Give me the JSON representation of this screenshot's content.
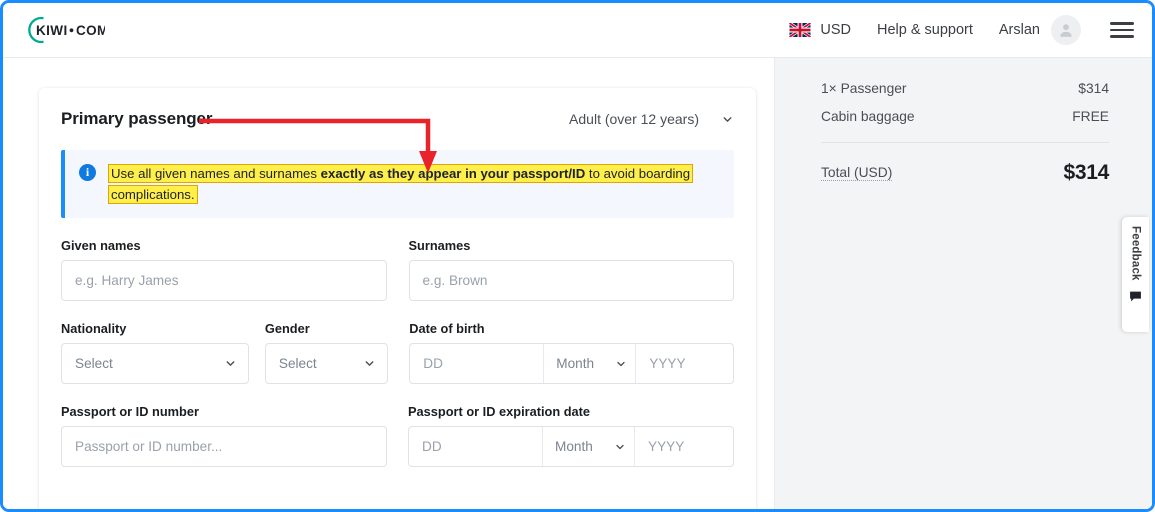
{
  "header": {
    "logo_text": "KIWI · COM",
    "logo_icon": "kiwi-circle-logo",
    "currency": "USD",
    "flag_icon": "uk-flag-icon",
    "help": "Help & support",
    "user_name": "Arslan",
    "avatar_icon": "user-avatar-icon",
    "menu_icon": "hamburger-menu-icon"
  },
  "card": {
    "title": "Primary passenger",
    "passenger_type": "Adult (over 12 years)",
    "passenger_type_chevron": "chevron-down-icon",
    "banner": {
      "icon": "info-circle-icon",
      "line1_part1": "Use all given names and surnames ",
      "line1_bold": "exactly as they appear in your passport/ID",
      "line1_part2": " to avoid boarding",
      "line2": "complications.",
      "highlight_color": "#ffef4a",
      "highlight_border": "#e0a500",
      "accent_color": "#1a8cff"
    },
    "fields": {
      "given_names": {
        "label": "Given names",
        "placeholder": "e.g. Harry James",
        "value": ""
      },
      "surnames": {
        "label": "Surnames",
        "placeholder": "e.g. Brown",
        "value": ""
      },
      "nationality": {
        "label": "Nationality",
        "value": "Select",
        "chevron": "chevron-down-icon"
      },
      "gender": {
        "label": "Gender",
        "value": "Select",
        "chevron": "chevron-down-icon"
      },
      "date_of_birth": {
        "label": "Date of birth",
        "day_placeholder": "DD",
        "month_placeholder": "Month",
        "year_placeholder": "YYYY",
        "chevron": "chevron-down-icon"
      },
      "passport_number": {
        "label": "Passport or ID number",
        "placeholder": "Passport or ID number...",
        "value": ""
      },
      "passport_expiration": {
        "label": "Passport or ID expiration date",
        "day_placeholder": "DD",
        "month_placeholder": "Month",
        "year_placeholder": "YYYY",
        "chevron": "chevron-down-icon"
      }
    }
  },
  "sidebar": {
    "rows": [
      {
        "label": "1× Passenger",
        "value": "$314"
      },
      {
        "label": "Cabin baggage",
        "value": "FREE"
      }
    ],
    "total_label": "Total (USD)",
    "total_value": "$314"
  },
  "feedback": {
    "label": "Feedback",
    "icon": "speech-bubble-icon"
  },
  "annotation": {
    "arrow_color": "#e8232a",
    "viewport_border_color": "#1a8cff"
  }
}
